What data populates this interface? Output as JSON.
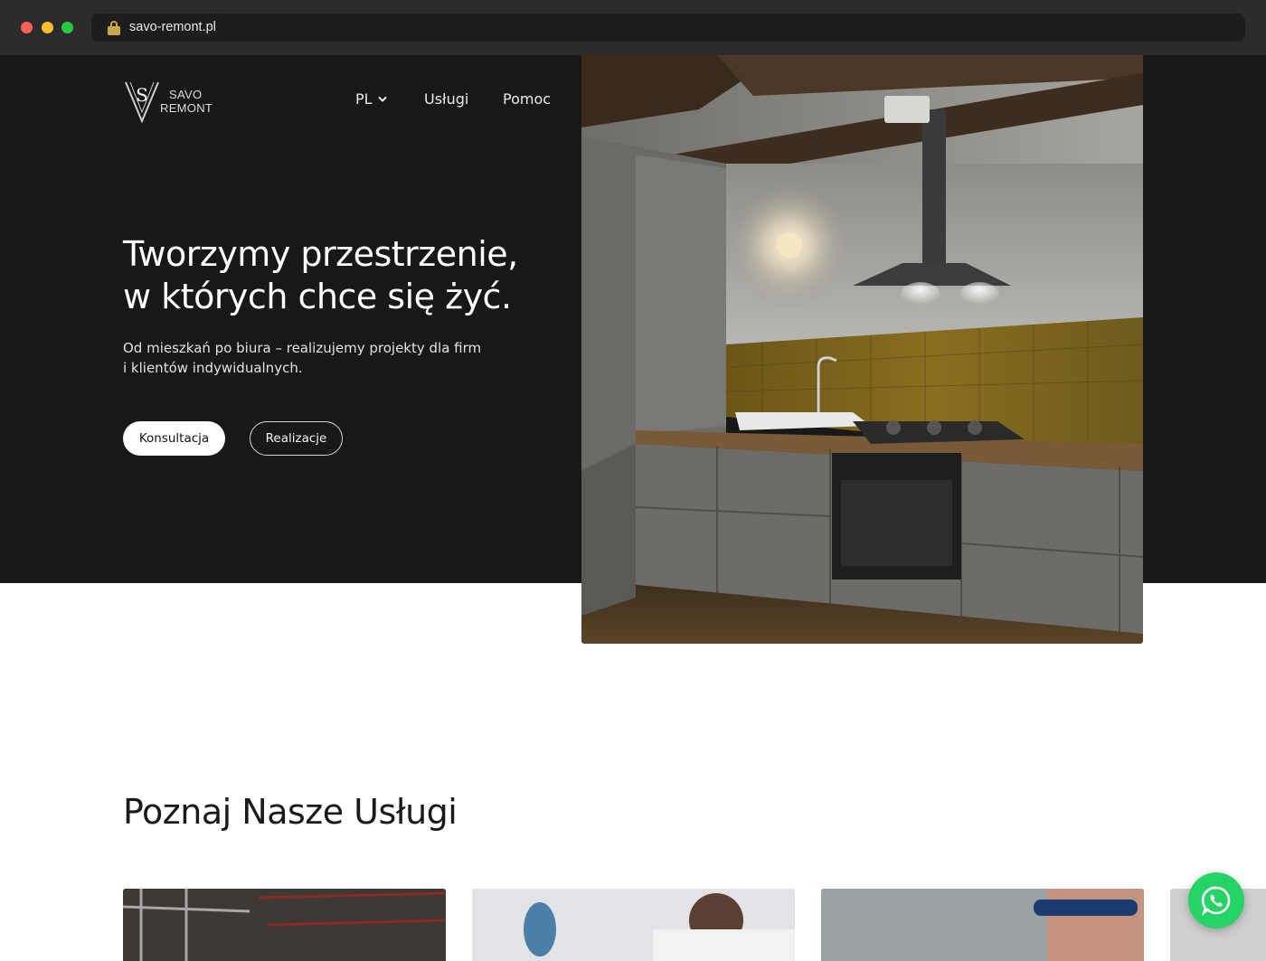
{
  "browser": {
    "url": "savo-remont.pl"
  },
  "header": {
    "logo": {
      "line1": "SAVO",
      "line2": "REMONT",
      "monogram": "S"
    },
    "nav": {
      "language": "PL",
      "services": "Usługi",
      "help": "Pomoc"
    }
  },
  "hero": {
    "title_line1": "Tworzymy przestrzenie,",
    "title_line2": "w których chce się żyć.",
    "subtitle": "Od mieszkań po biura – realizujemy projekty dla firm i klientów indywidualnych.",
    "primary_button": "Konsultacja",
    "secondary_button": "Realizacje"
  },
  "services": {
    "title": "Poznaj Nasze Usługi"
  },
  "icons": {
    "lock": "lock-icon",
    "chevron": "chevron-down-icon",
    "whatsapp": "whatsapp-icon"
  },
  "colors": {
    "hero_bg": "#181818",
    "whatsapp": "#25d366",
    "accent_gold": "#c9a64a"
  }
}
